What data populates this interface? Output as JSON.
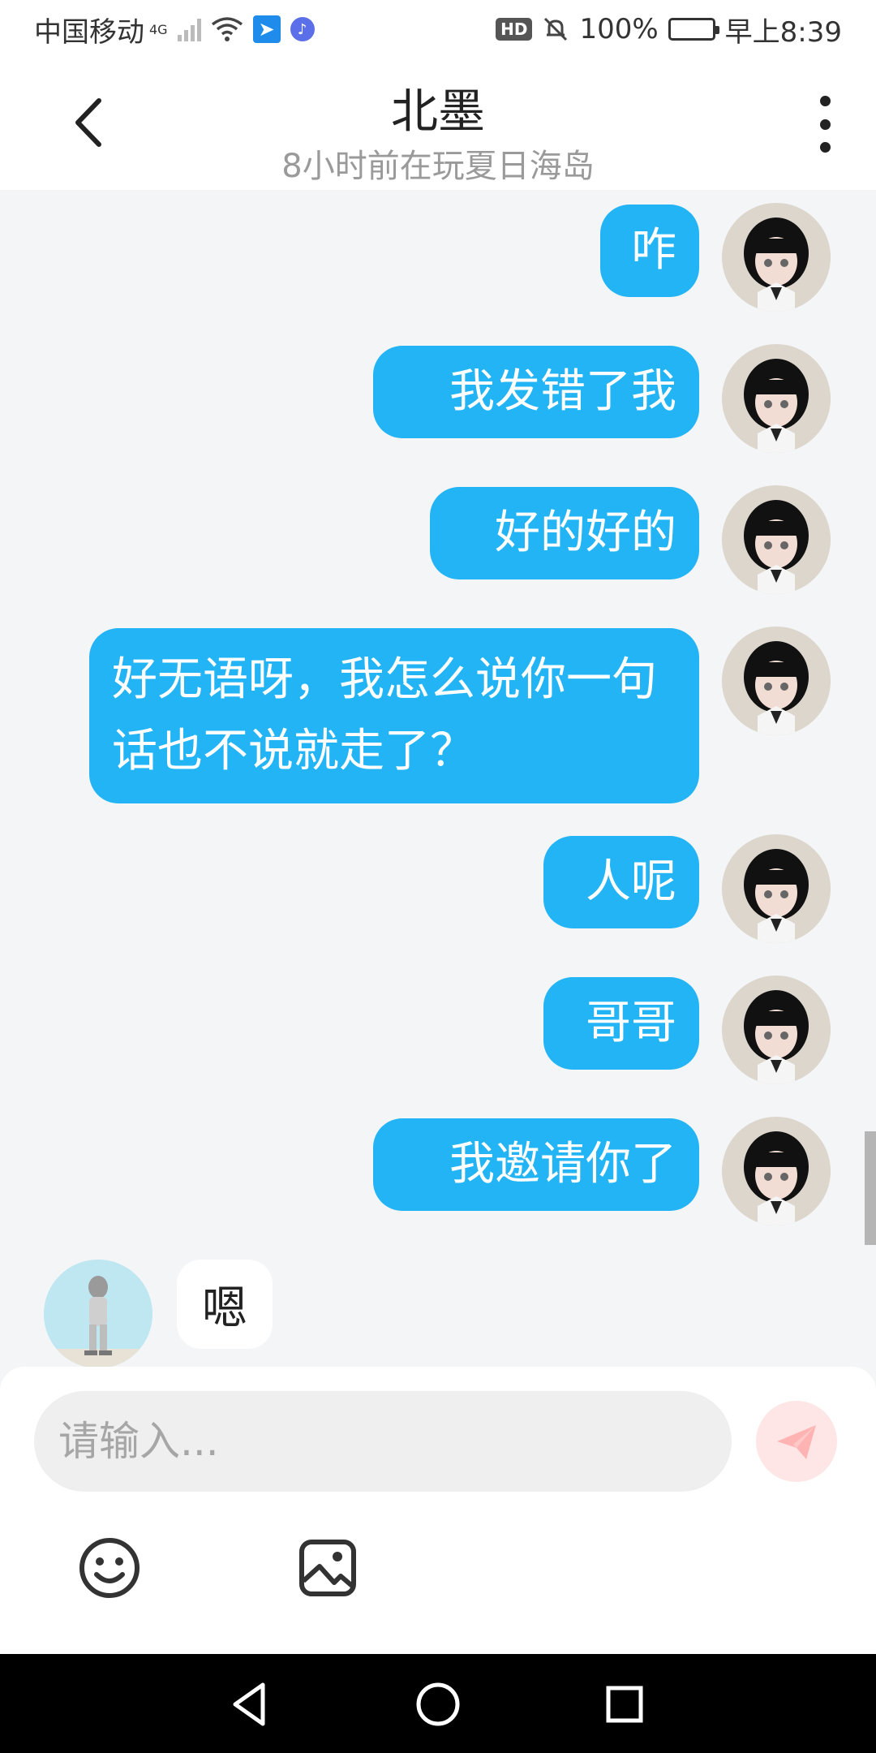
{
  "status_bar": {
    "carrier": "中国移动",
    "network": "4G",
    "battery": "100%",
    "time": "早上8:39"
  },
  "header": {
    "title": "北墨",
    "subtitle": "8小时前在玩夏日海岛"
  },
  "messages": [
    {
      "sender": "me",
      "text": "咋"
    },
    {
      "sender": "me",
      "text": "我发错了我"
    },
    {
      "sender": "me",
      "text": "好的好的"
    },
    {
      "sender": "me",
      "text": "好无语呀，我怎么说你一句话也不说就走了？"
    },
    {
      "sender": "me",
      "text": "人呢"
    },
    {
      "sender": "me",
      "text": "哥哥"
    },
    {
      "sender": "me",
      "text": "我邀请你了"
    },
    {
      "sender": "other",
      "text": "嗯"
    }
  ],
  "composer": {
    "placeholder": "请输入..."
  },
  "colors": {
    "my_bubble": "#22b4f5",
    "other_bubble": "#ffffff",
    "background": "#f4f5f7"
  },
  "icons": {
    "back": "back-arrow-icon",
    "more": "more-vertical-icon",
    "send": "paper-plane-icon",
    "emoji": "smiley-icon",
    "image": "image-icon",
    "nav_back": "triangle-back-icon",
    "nav_home": "circle-home-icon",
    "nav_recent": "square-recent-icon"
  }
}
